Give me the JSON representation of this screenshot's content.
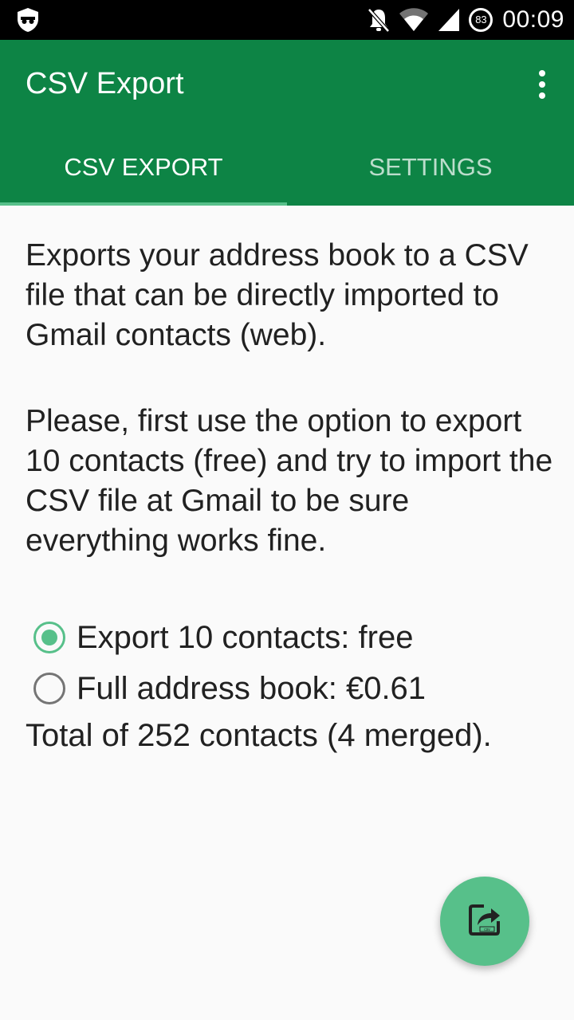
{
  "status_bar": {
    "left_icon": "incognito-shield-icon",
    "icons": [
      "notifications-off-icon",
      "wifi-icon",
      "signal-icon"
    ],
    "battery_level": "83",
    "time": "00:09"
  },
  "app_bar": {
    "title": "CSV Export",
    "menu_icon": "overflow-menu-icon"
  },
  "tabs": [
    {
      "label": "CSV EXPORT",
      "selected": true
    },
    {
      "label": "SETTINGS",
      "selected": false
    }
  ],
  "content": {
    "paragraph1": "Exports your address book to a CSV file that can be directly imported to Gmail contacts (web).",
    "paragraph2": "Please, first use the option to export 10 contacts (free) and try to import the CSV file at Gmail to be sure everything works fine.",
    "options": [
      {
        "label": "Export 10 contacts: free",
        "checked": true
      },
      {
        "label": "Full address book: €0.61",
        "checked": false
      }
    ],
    "total": "Total of 252 contacts (4 merged)."
  },
  "fab": {
    "icon": "export-csv-icon"
  },
  "colors": {
    "primary": "#0d8445",
    "accent": "#57c08a",
    "background": "#fafafa",
    "text": "#212121"
  }
}
